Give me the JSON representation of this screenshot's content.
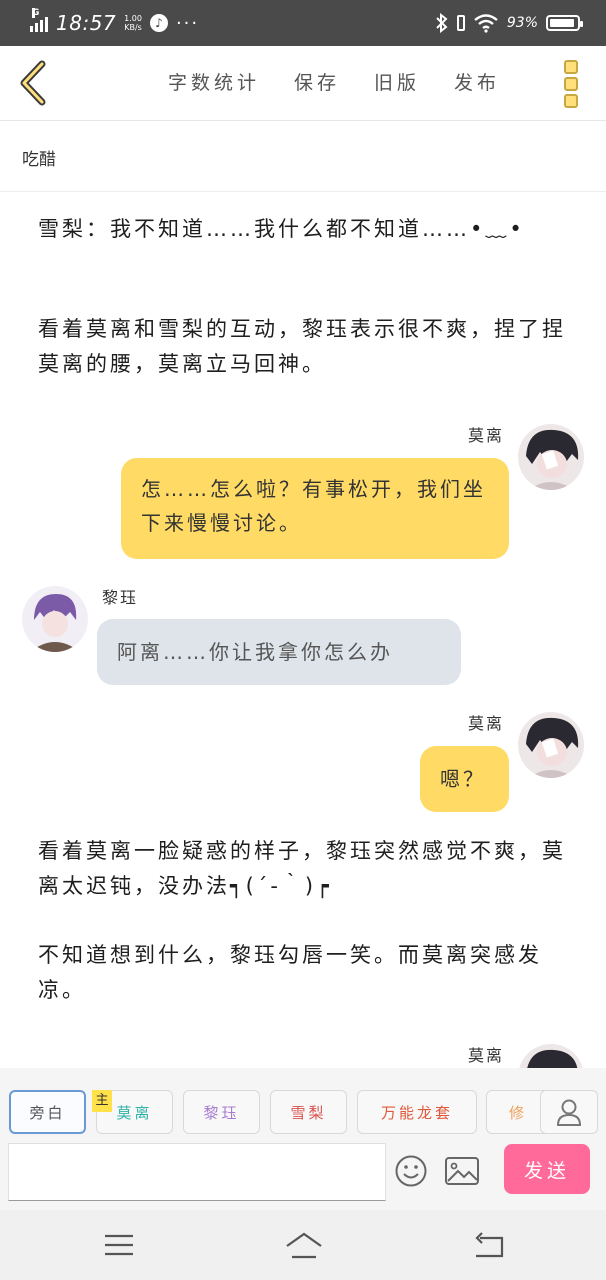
{
  "status_bar": {
    "network": "G",
    "time": "18:57",
    "speed_value": "1.00",
    "speed_unit": "KB/s",
    "more": "···",
    "battery": "93%",
    "battery_level": 0.93
  },
  "toolbar": {
    "items": [
      "字数统计",
      "保存",
      "旧版",
      "发布"
    ]
  },
  "title": "吃醋",
  "content": {
    "para1": "雪梨：我不知道……我什么都不知道……•﹏•",
    "para2": "看着莫离和雪梨的互动，黎珏表示很不爽，捏了捏莫离的腰，莫离立马回神。",
    "msg1": {
      "speaker": "莫离",
      "text": "怎……怎么啦？有事松开，我们坐下来慢慢讨论。"
    },
    "msg2": {
      "speaker": "黎珏",
      "text": "阿离……你让我拿你怎么办"
    },
    "msg3": {
      "speaker": "莫离",
      "text": "嗯？"
    },
    "para3": "看着莫离一脸疑惑的样子，黎珏突然感觉不爽，莫离太迟钝，没办法┑(´-｀)┍",
    "para4": "不知道想到什么，黎珏勾唇一笑。而莫离突感发凉。",
    "msg4": {
      "speaker": "莫离"
    }
  },
  "roles": {
    "narration": "旁白",
    "main_badge": "主",
    "list": [
      "莫离",
      "黎珏",
      "雪梨",
      "万能龙套",
      "修"
    ],
    "colors": {
      "narration": "#555555",
      "moli": "#2fb3a6",
      "lijue": "#a77bd0",
      "xueli": "#d9534f",
      "wanneng": "#e0593a",
      "xiu": "#f0a15a"
    }
  },
  "input": {
    "placeholder": "",
    "send_label": "发送"
  },
  "colors": {
    "status_bar": "#4a4a4a",
    "bubble_yellow": "#ffdb66",
    "bubble_grey": "#dfe4eb",
    "send_button": "#ff6a9a",
    "accent": "#c8a640"
  }
}
